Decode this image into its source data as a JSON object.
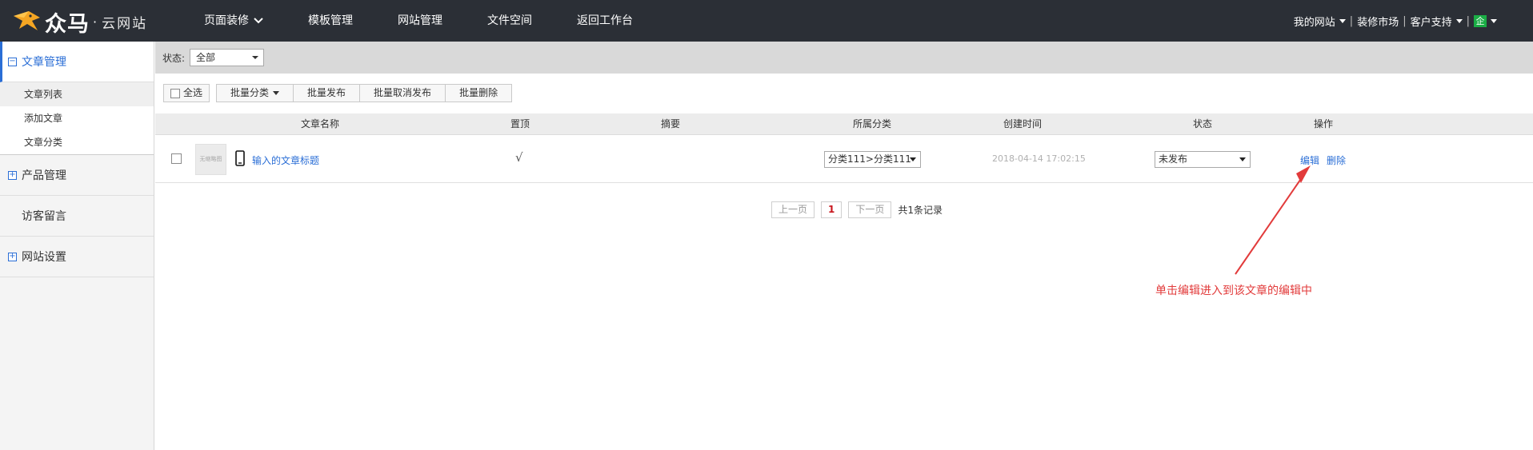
{
  "header": {
    "logo_text": "众马",
    "logo_dot": "·",
    "logo_sub": "云网站",
    "nav": [
      "页面装修",
      "模板管理",
      "网站管理",
      "文件空间",
      "返回工作台"
    ],
    "right": {
      "my_site": "我的网站",
      "market": "装修市场",
      "support": "客户支持",
      "badge": "企"
    }
  },
  "sidebar": {
    "article_mgmt": "文章管理",
    "article_items": [
      "文章列表",
      "添加文章",
      "文章分类"
    ],
    "product_mgmt": "产品管理",
    "guestbook": "访客留言",
    "site_settings": "网站设置",
    "collapse_glyph": "−",
    "expand_glyph": "+"
  },
  "filter": {
    "label": "状态:",
    "value": "全部"
  },
  "toolbar": {
    "select_all": "全选",
    "batch_category": "批量分类",
    "batch_publish": "批量发布",
    "batch_unpublish": "批量取消发布",
    "batch_delete": "批量删除"
  },
  "table": {
    "headers": [
      "文章名称",
      "置顶",
      "摘要",
      "所属分类",
      "创建时间",
      "状态",
      "操作"
    ],
    "rows": [
      {
        "thumb": "无缩略图",
        "title": "输入的文章标题",
        "pinned": "√",
        "summary": "",
        "category": "分类111>分类111",
        "created": "2018-04-14 17:02:15",
        "status": "未发布",
        "edit": "编辑",
        "delete": "删除"
      }
    ]
  },
  "pager": {
    "prev": "上一页",
    "current": "1",
    "next": "下一页",
    "total": "共1条记录"
  },
  "annotation": {
    "text": "单击编辑进入到该文章的编辑中",
    "color": "#e23b3b"
  },
  "colors": {
    "topbar": "#2b2f36",
    "accent": "#2a6ed6",
    "badge": "#1aad45"
  }
}
